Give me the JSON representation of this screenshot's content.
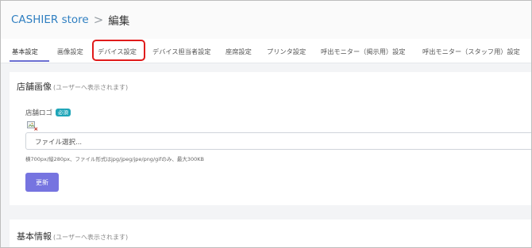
{
  "header": {
    "store_name": "CASHIER store",
    "separator": ">",
    "current_page": "編集"
  },
  "tabs": [
    {
      "label": "基本設定",
      "active": true
    },
    {
      "label": "画像設定",
      "active": false
    },
    {
      "label": "デバイス設定",
      "active": false,
      "highlighted": true
    },
    {
      "label": "デバイス担当者設定",
      "active": false
    },
    {
      "label": "座席設定",
      "active": false
    },
    {
      "label": "プリンタ設定",
      "active": false
    },
    {
      "label": "呼出モニター（掲示用）設定",
      "active": false
    },
    {
      "label": "呼出モニター（スタッフ用）設定",
      "active": false
    }
  ],
  "store_image": {
    "title": "店舗画像",
    "note": "(ユーザーへ表示されます)",
    "logo_label": "店舗ロゴ",
    "required_badge": "必須",
    "file_input_text": "ファイル選択...",
    "help_text": "横700px/縦280px、ファイル形式はjpg/jpeg/jpe/png/gifのみ、最大300KB",
    "update_button": "更新"
  },
  "basic_info": {
    "title": "基本情報",
    "note": "(ユーザーへ表示されます)"
  },
  "colors": {
    "accent": "#7674e0",
    "link": "#2f7fc1",
    "highlight_box": "#e01b1b",
    "badge": "#1ea5b8"
  }
}
